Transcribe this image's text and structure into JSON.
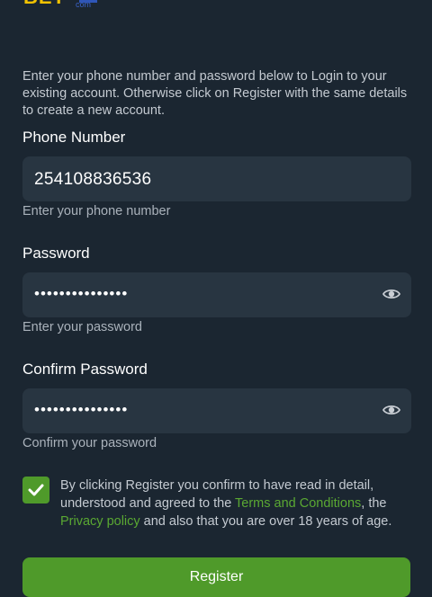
{
  "logo": {
    "text": "BET",
    "sub": "com"
  },
  "intro": "Enter your phone number and password below to Login to your existing account. Otherwise click on Register with the same details to create a new account.",
  "phone": {
    "label": "Phone Number",
    "value": "254108836536",
    "helper": "Enter your phone number"
  },
  "password": {
    "label": "Password",
    "masked": "•••••••••••••••",
    "helper": "Enter your password",
    "toggle_icon": "eye-icon"
  },
  "confirm_password": {
    "label": "Confirm Password",
    "masked": "•••••••••••••••",
    "helper": "Confirm your password",
    "toggle_icon": "eye-icon"
  },
  "consent": {
    "checked": true,
    "text_before": "By clicking Register you confirm to have read in detail, understood and agreed to the ",
    "terms_link": "Terms and Conditions",
    "text_middle1": ", the ",
    "privacy_link": "Privacy policy",
    "text_after": " and also that you are over 18 years of age."
  },
  "register_button": "Register",
  "colors": {
    "background": "#1b2631",
    "field": "#283541",
    "accent": "#4f9a2a",
    "link": "#5aa832"
  }
}
